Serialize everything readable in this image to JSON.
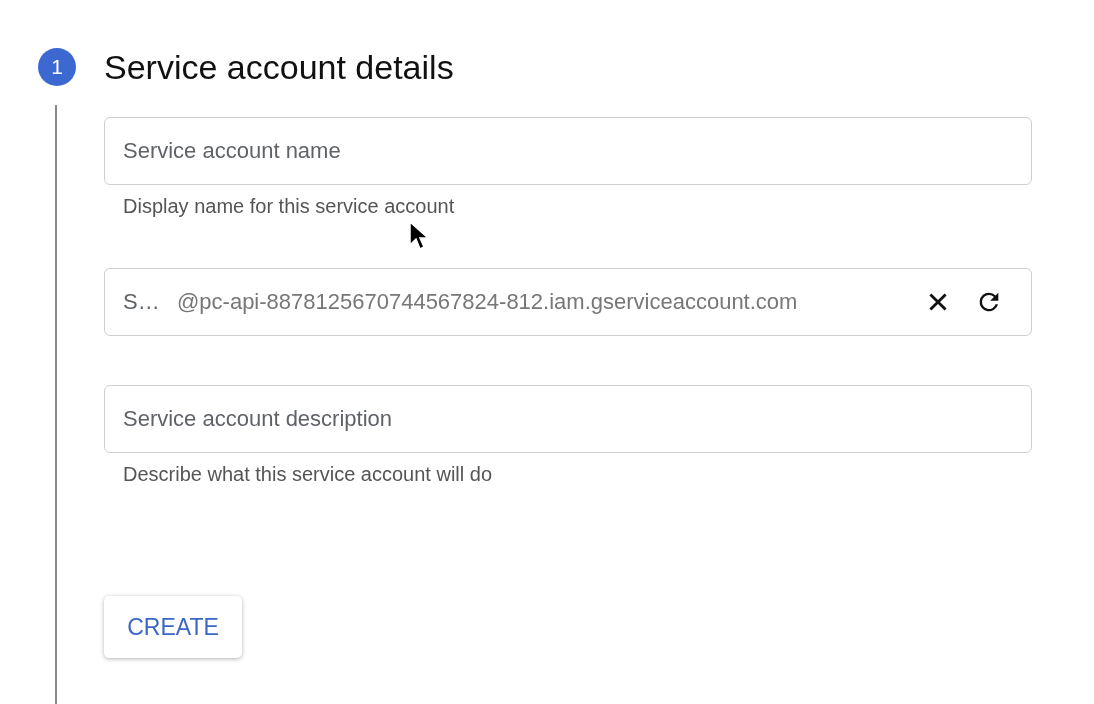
{
  "step": {
    "number": "1",
    "title": "Service account details"
  },
  "fields": [
    {
      "kind": "text",
      "placeholder": "Service account name",
      "helper": "Display name for this service account"
    },
    {
      "kind": "id",
      "placeholder": "S…",
      "suffix": "@pc-api-8878125670744567824-812.iam.gserviceaccount.com"
    },
    {
      "kind": "text",
      "placeholder": "Service account description",
      "helper": "Describe what this service account will do"
    }
  ],
  "create_button": "CREATE"
}
